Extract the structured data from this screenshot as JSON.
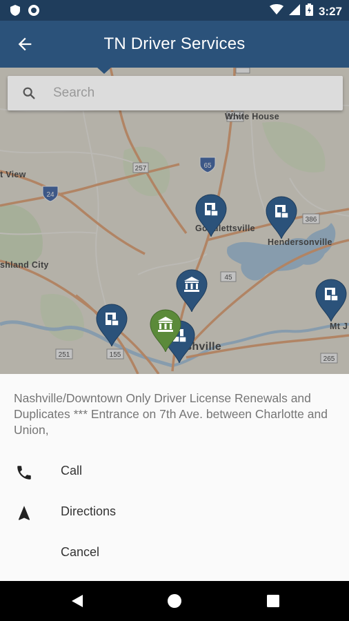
{
  "status_bar": {
    "time": "3:27",
    "icons": [
      "shield-icon",
      "circle-icon",
      "wifi-icon",
      "signal-icon",
      "battery-icon"
    ]
  },
  "app_bar": {
    "title": "TN Driver Services",
    "back_icon": "arrow-back-icon"
  },
  "search": {
    "placeholder": "Search",
    "icon": "search-icon"
  },
  "map": {
    "labels": [
      {
        "text": "White House",
        "kind": "town"
      },
      {
        "text": "t View",
        "kind": "town"
      },
      {
        "text": "shland City",
        "kind": "town"
      },
      {
        "text": "Hendersonville",
        "kind": "town"
      },
      {
        "text": "Goodlettsville",
        "kind": "town"
      },
      {
        "text": "Mt J",
        "kind": "town"
      },
      {
        "text": "ashville",
        "kind": "city"
      },
      {
        "text": "31W",
        "kind": "route"
      },
      {
        "text": "257",
        "kind": "route"
      },
      {
        "text": "65",
        "kind": "interstate"
      },
      {
        "text": "24",
        "kind": "interstate"
      },
      {
        "text": "386",
        "kind": "route"
      },
      {
        "text": "45",
        "kind": "route"
      },
      {
        "text": "251",
        "kind": "route"
      },
      {
        "text": "155",
        "kind": "route"
      },
      {
        "text": "265",
        "kind": "route"
      },
      {
        "text": "25",
        "kind": "route"
      }
    ],
    "pins": [
      {
        "name": "license-office-pin",
        "icon": "id-card-icon",
        "color": "#2b527a"
      },
      {
        "name": "license-office-pin",
        "icon": "id-card-icon",
        "color": "#2b527a"
      },
      {
        "name": "government-building-pin",
        "icon": "bank-icon",
        "color": "#2b527a"
      },
      {
        "name": "license-office-pin",
        "icon": "id-card-icon",
        "color": "#2b527a"
      },
      {
        "name": "license-office-pin",
        "icon": "id-card-icon",
        "color": "#2b527a"
      },
      {
        "name": "license-office-pin",
        "icon": "id-card-icon",
        "color": "#2b527a"
      },
      {
        "name": "selected-location-pin",
        "icon": "bank-icon",
        "color": "#5b8a3a"
      }
    ]
  },
  "sheet": {
    "description": "Nashville/Downtown Only Driver License Renewals and Duplicates *** Entrance on 7th Ave. between Charlotte and Union,",
    "actions": [
      {
        "label": "Call",
        "icon": "phone-icon"
      },
      {
        "label": "Directions",
        "icon": "navigation-arrow-icon"
      },
      {
        "label": "Cancel",
        "icon": ""
      }
    ]
  },
  "nav_bar": {
    "buttons": [
      "back-triangle-icon",
      "home-circle-icon",
      "recents-square-icon"
    ]
  },
  "colors": {
    "app_bar": "#2b527a",
    "status_bar": "#1f3d5c",
    "pin_blue": "#2b527a",
    "pin_green": "#5b8a3a"
  }
}
